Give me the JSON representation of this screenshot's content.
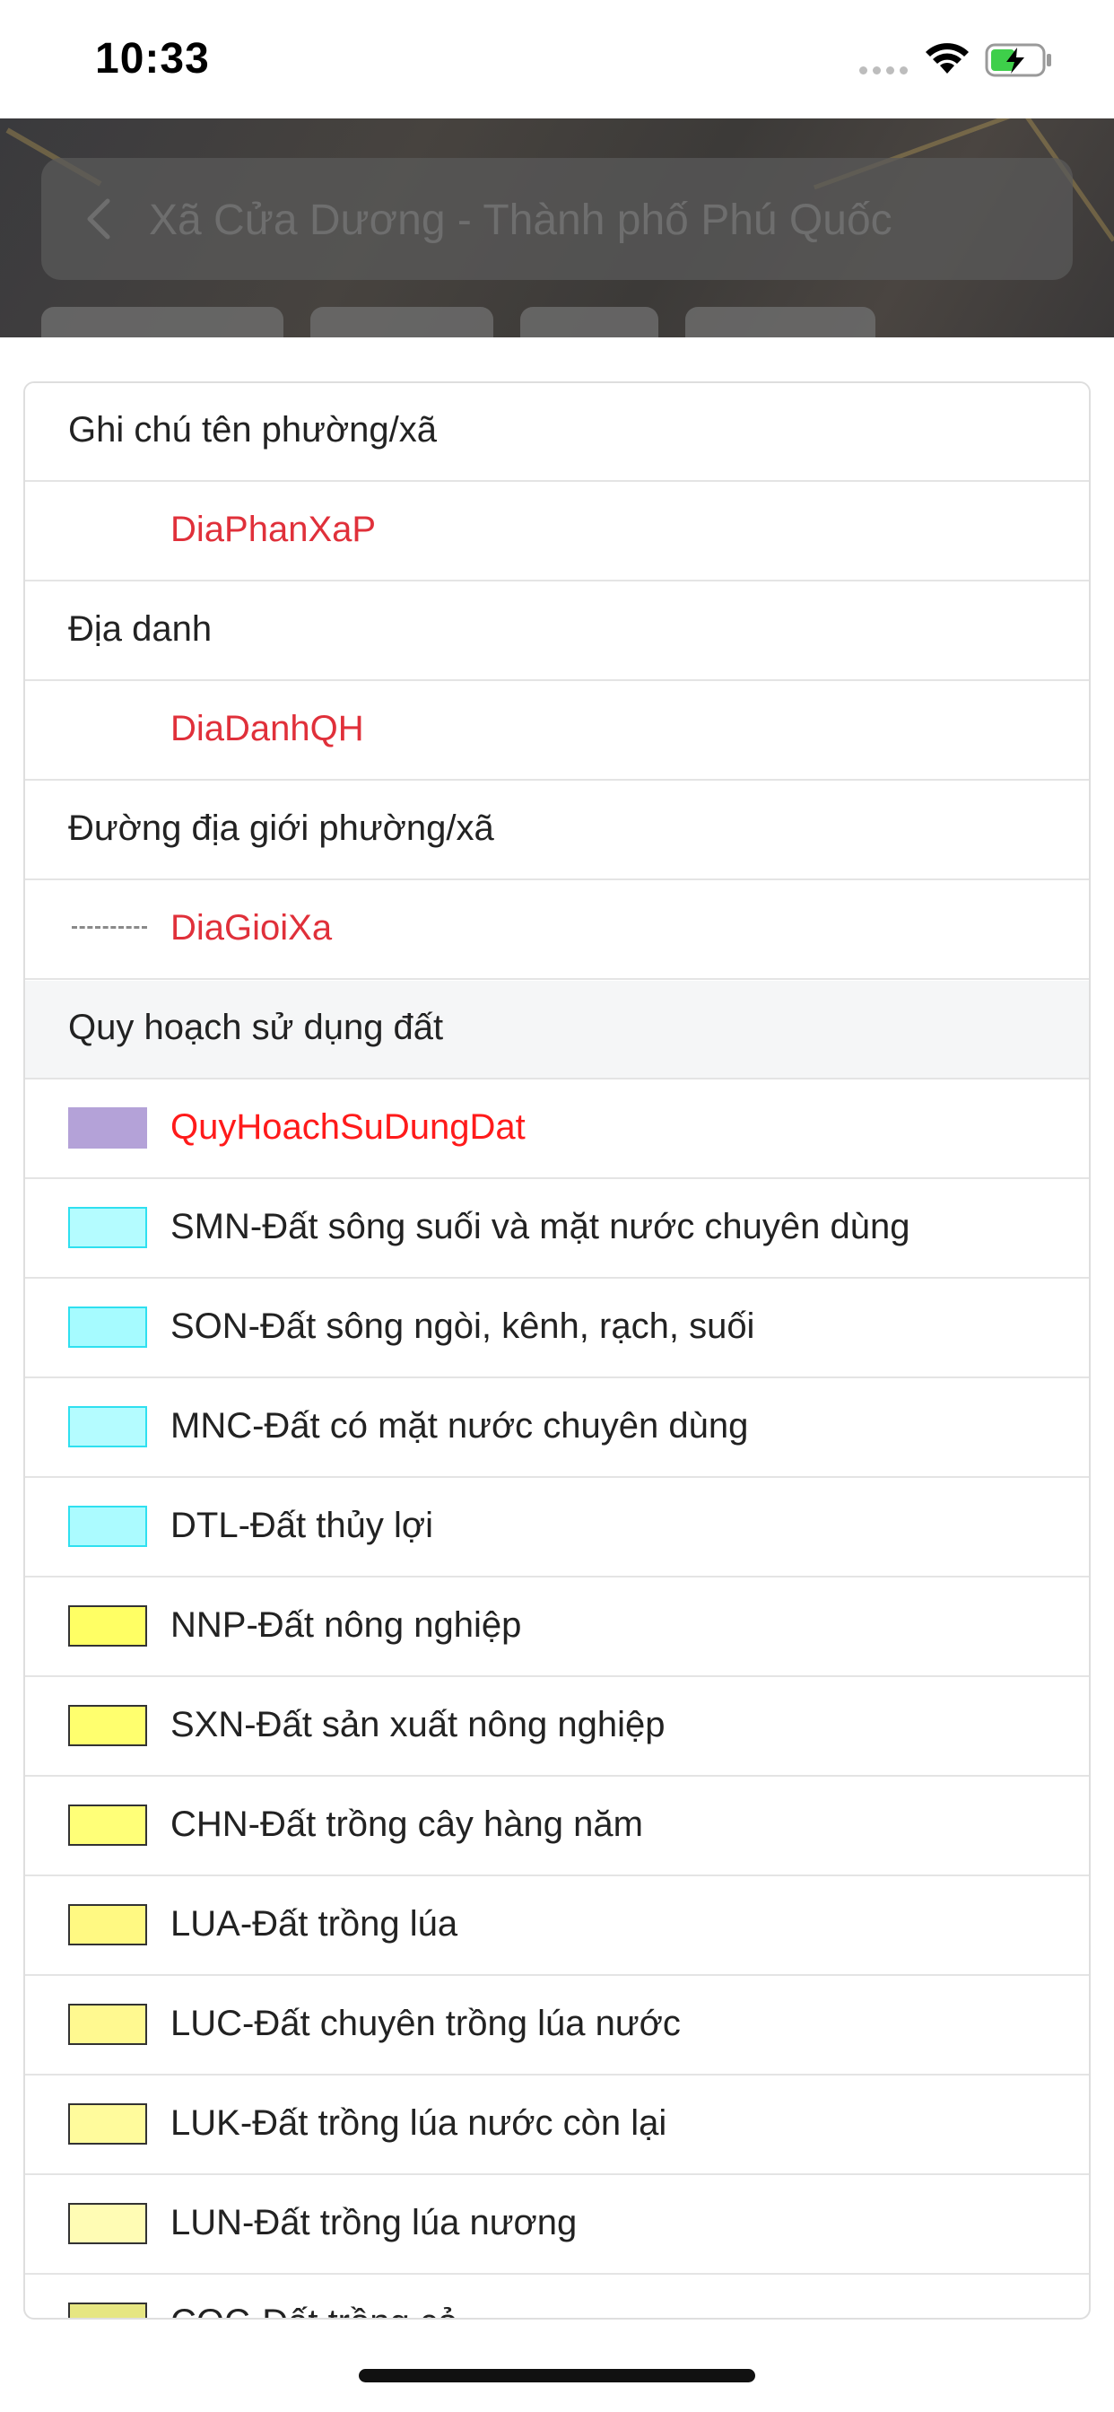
{
  "status_bar": {
    "time": "10:33"
  },
  "header": {
    "title": "Xã Cửa Dương - Thành phố Phú Quốc"
  },
  "legend": {
    "rows": [
      {
        "kind": "group",
        "label": "Ghi chú tên phường/xã"
      },
      {
        "kind": "item",
        "label": "DiaPhanXaP",
        "label_color": "#e0303a",
        "swatch": "none"
      },
      {
        "kind": "group",
        "label": "Địa danh"
      },
      {
        "kind": "item",
        "label": "DiaDanhQH",
        "label_color": "#e0303a",
        "swatch": "none"
      },
      {
        "kind": "group",
        "label": "Đường địa giới phường/xã"
      },
      {
        "kind": "item",
        "label": "DiaGioiXa",
        "label_color": "#e0303a",
        "swatch": "dash"
      },
      {
        "kind": "group",
        "label": "Quy hoạch sử dụng đất",
        "shaded": true
      },
      {
        "kind": "item",
        "label": "QuyHoachSuDungDat",
        "label_color": "#ff1a1a",
        "swatch": "#b4a2d8",
        "swatch_border": "#b4a2d8"
      },
      {
        "kind": "item",
        "label": "SMN-Đất sông suối và mặt nước chuyên dùng",
        "swatch": "#b4fcff",
        "swatch_border": "#2fe0f0"
      },
      {
        "kind": "item",
        "label": "SON-Đất sông ngòi, kênh, rạch, suối",
        "swatch": "#a6fbff",
        "swatch_border": "#2fe0f0"
      },
      {
        "kind": "item",
        "label": "MNC-Đất có mặt nước chuyên dùng",
        "swatch": "#b4fcff",
        "swatch_border": "#2fe0f0"
      },
      {
        "kind": "item",
        "label": "DTL-Đất thủy lợi",
        "swatch": "#abfbff",
        "swatch_border": "#2fe0f0"
      },
      {
        "kind": "item",
        "label": "NNP-Đất nông nghiệp",
        "swatch": "#ffff64",
        "swatch_border": "#333333"
      },
      {
        "kind": "item",
        "label": "SXN-Đất sản xuất nông nghiệp",
        "swatch": "#ffff6e",
        "swatch_border": "#333333"
      },
      {
        "kind": "item",
        "label": "CHN-Đất trồng cây hàng năm",
        "swatch": "#ffff78",
        "swatch_border": "#333333"
      },
      {
        "kind": "item",
        "label": "LUA-Đất trồng lúa",
        "swatch": "#fff982",
        "swatch_border": "#333333"
      },
      {
        "kind": "item",
        "label": "LUC-Đất chuyên trồng lúa nước",
        "swatch": "#fff990",
        "swatch_border": "#333333"
      },
      {
        "kind": "item",
        "label": "LUK-Đất trồng lúa nước còn lại",
        "swatch": "#fffb9c",
        "swatch_border": "#333333"
      },
      {
        "kind": "item",
        "label": "LUN-Đất trồng lúa nương",
        "swatch": "#fffcb4",
        "swatch_border": "#333333"
      },
      {
        "kind": "item",
        "label": "COC-Đất trồng cỏ",
        "swatch": "#e6e682",
        "swatch_border": "#333333"
      }
    ]
  }
}
